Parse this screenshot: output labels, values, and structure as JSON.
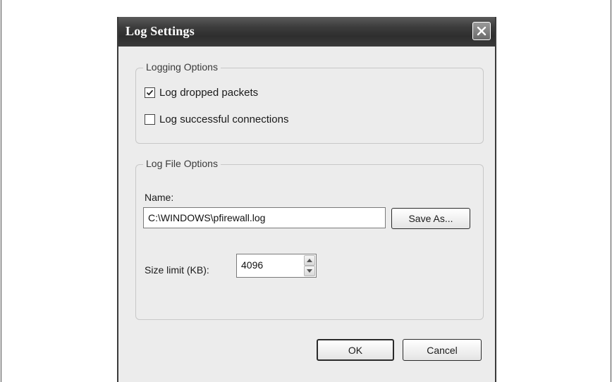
{
  "dialog": {
    "title": "Log Settings",
    "close_icon": "close-icon"
  },
  "logging_options": {
    "legend": "Logging Options",
    "items": [
      {
        "label": "Log dropped packets",
        "checked": true
      },
      {
        "label": "Log successful connections",
        "checked": false
      }
    ]
  },
  "log_file_options": {
    "legend": "Log File Options",
    "name_label": "Name:",
    "name_value": "C:\\WINDOWS\\pfirewall.log",
    "save_as_label": "Save As...",
    "size_label": "Size limit (KB):",
    "size_value": "4096"
  },
  "buttons": {
    "ok_label": "OK",
    "cancel_label": "Cancel"
  }
}
